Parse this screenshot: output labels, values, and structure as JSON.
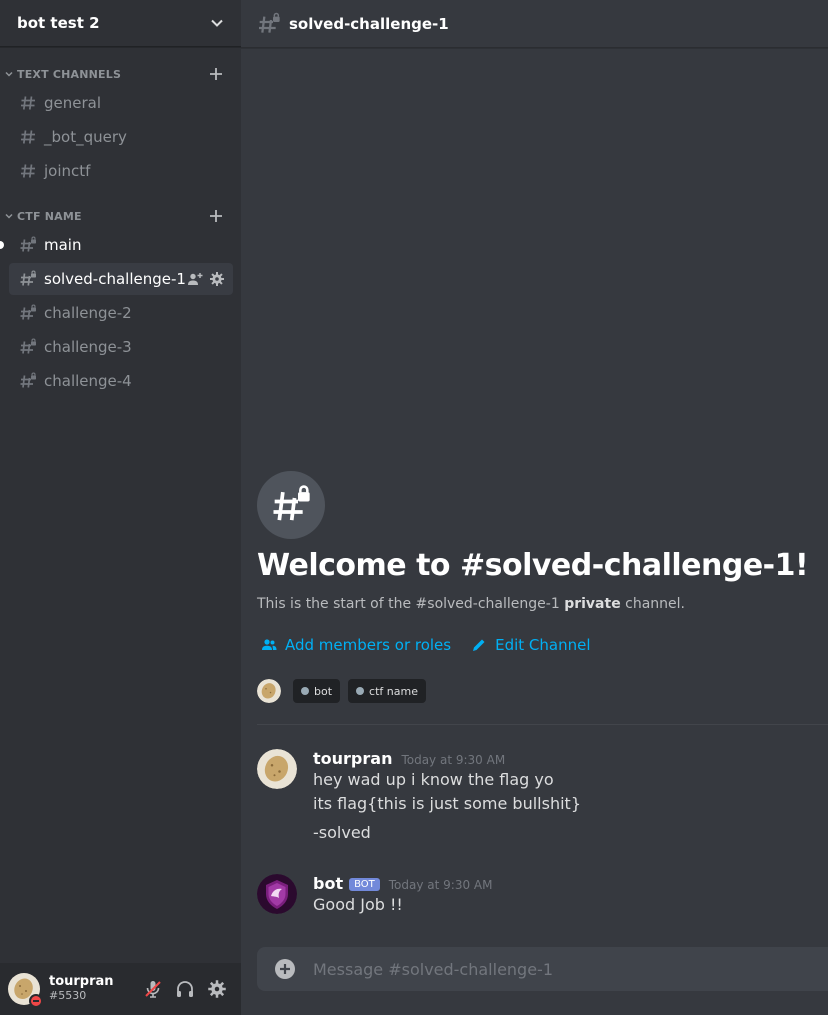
{
  "server": {
    "name": "bot test 2"
  },
  "categories": [
    {
      "label": "TEXT CHANNELS"
    },
    {
      "label": "CTF NAME"
    }
  ],
  "channels": [
    {
      "name": "general"
    },
    {
      "name": "_bot_query"
    },
    {
      "name": "joinctf"
    },
    {
      "name": "main"
    },
    {
      "name": "solved-challenge-1"
    },
    {
      "name": "challenge-2"
    },
    {
      "name": "challenge-3"
    },
    {
      "name": "challenge-4"
    }
  ],
  "user": {
    "name": "tourpran",
    "tag": "#5530"
  },
  "header": {
    "channel": "solved-challenge-1"
  },
  "welcome": {
    "title": "Welcome to #solved-challenge-1!",
    "sub_prefix": "This is the start of the #solved-challenge-1",
    "sub_bold": "private",
    "sub_suffix": "channel.",
    "add_members": "Add members or roles",
    "edit_channel": "Edit Channel"
  },
  "roles": [
    "bot",
    "ctf name"
  ],
  "messages": [
    {
      "author": "tourpran",
      "time": "Today at 9:30 AM",
      "lines": [
        "hey wad up i know the flag yo",
        "its flag{this is just some bullshit}",
        "-solved"
      ]
    },
    {
      "author": "bot",
      "badge": "BOT",
      "time": "Today at 9:30 AM",
      "lines": [
        "Good Job !!"
      ]
    }
  ],
  "composer": {
    "placeholder": "Message #solved-challenge-1"
  },
  "colors": {
    "sidebar": "#2f3136",
    "main": "#36393f",
    "link": "#00b0f4",
    "bot_badge": "#7289da",
    "dnd": "#f04747"
  }
}
